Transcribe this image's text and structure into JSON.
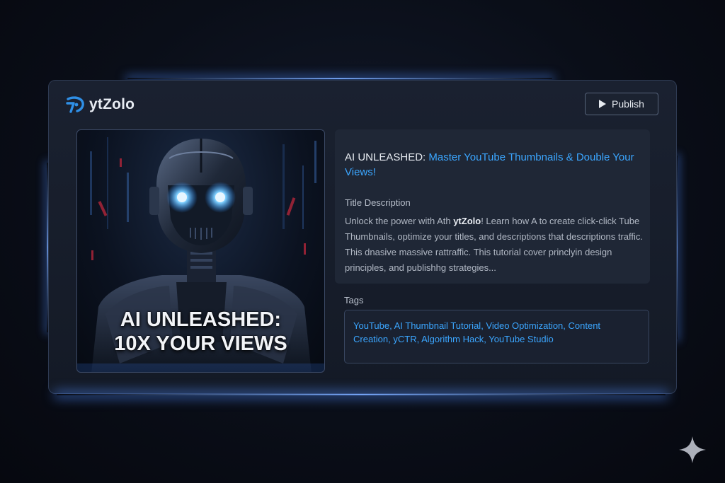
{
  "app": {
    "logo_text": "ytZolo"
  },
  "toolbar": {
    "publish_label": "Publish",
    "publish_icon": "play-icon"
  },
  "thumbnail": {
    "overlay_line1": "AI UNLEASHED:",
    "overlay_line2": "10X YOUR VIEWS",
    "subject": "robot-figure"
  },
  "video": {
    "title_lead": "AI UNLEASHED: ",
    "title_accent": "Master YouTube Thumbnails & Double Your Views!",
    "description_label": "Title Description",
    "description_pre": "Unlock the power with Ath ",
    "description_brand": "ytZolo",
    "description_post": "! Learn how A to create click-click Tube Thumbnails, optimize your titles, and descriptions that descriptions traffic. This dnasive massive rattraffic. This tutorial cover princlyin design principles, and publishhg strategies...",
    "tags_label": "Tags",
    "tags_text": "YouTube, AI Thumbnail Tutorial, Video Optimization, Content Creation, yCTR, Algorithm Hack, YouTube Studio"
  },
  "colors": {
    "accent": "#3ba6ff",
    "panel": "#1a2130",
    "glow": "#78aaff"
  }
}
